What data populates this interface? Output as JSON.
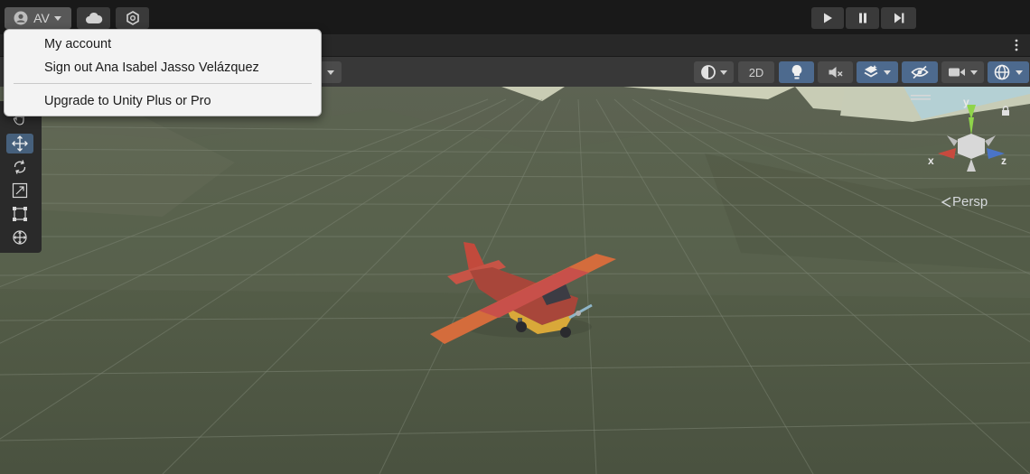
{
  "account": {
    "initials": "AV"
  },
  "account_menu": {
    "items": [
      {
        "label": "My account"
      },
      {
        "label": "Sign out Ana Isabel Jasso Velázquez"
      },
      {
        "label": "Upgrade to Unity Plus or Pro"
      }
    ]
  },
  "scene_toolbar": {
    "mode_2d_label": "2D"
  },
  "scene_view": {
    "projection_label": "Persp"
  },
  "gizmo": {
    "x_label": "x",
    "y_label": "y",
    "z_label": "z"
  },
  "icons": [
    "account-icon",
    "chevron-down-icon",
    "cloud-icon",
    "unity-services-icon",
    "play-icon",
    "pause-icon",
    "step-icon",
    "kebab-menu-icon",
    "hand-tool-icon",
    "move-tool-icon",
    "rotate-tool-icon",
    "scale-tool-icon",
    "rect-tool-icon",
    "transform-tool-icon",
    "draw-mode-icon",
    "lighting-icon",
    "audio-mute-icon",
    "effects-icon",
    "hidden-objects-icon",
    "camera-icon",
    "gizmos-icon",
    "lock-icon",
    "menu-lines-icon"
  ],
  "colors": {
    "accent_blue": "#4d6a8e",
    "active_tool": "#46607c",
    "grid_ground": "#58614b"
  }
}
